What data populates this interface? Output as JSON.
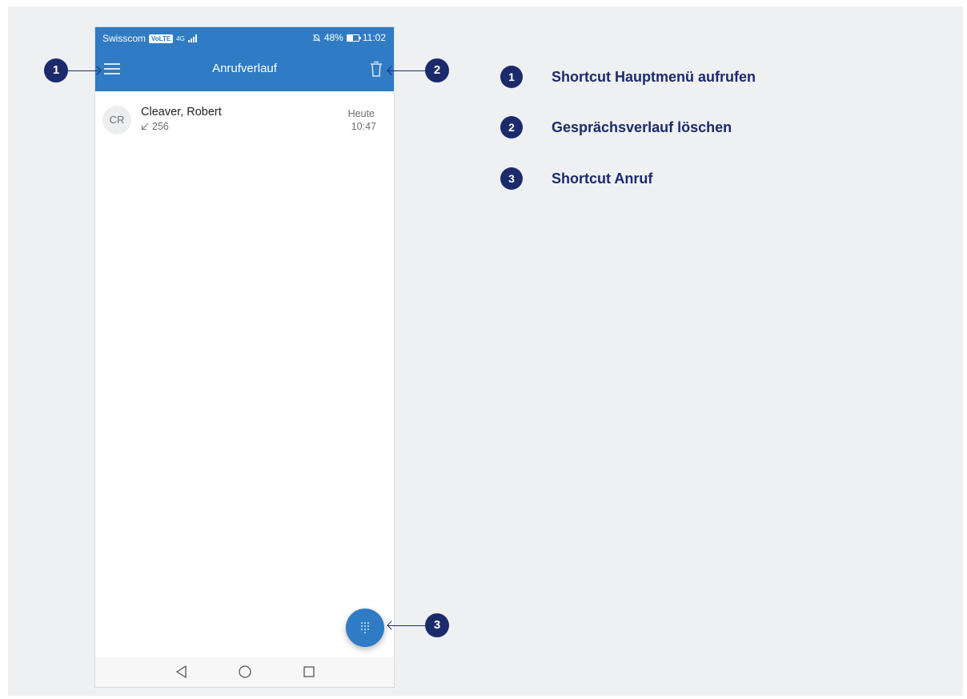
{
  "status_bar": {
    "carrier": "Swisscom",
    "volte": "VoLTE",
    "network": "4G",
    "battery_percent": "48%",
    "battery_level": 0.48,
    "time": "11:02"
  },
  "app_bar": {
    "title": "Anrufverlauf"
  },
  "call_history": [
    {
      "initials": "CR",
      "name": "Cleaver, Robert",
      "number": "256",
      "day": "Heute",
      "time": "10:47"
    }
  ],
  "callouts": [
    {
      "number": "1",
      "label": "Shortcut Hauptmenü aufrufen"
    },
    {
      "number": "2",
      "label": "Gesprächsverlauf löschen"
    },
    {
      "number": "3",
      "label": "Shortcut Anruf"
    }
  ],
  "colors": {
    "primary": "#2f7bc4",
    "callout": "#1b2a6b",
    "background": "#eef0f2"
  }
}
